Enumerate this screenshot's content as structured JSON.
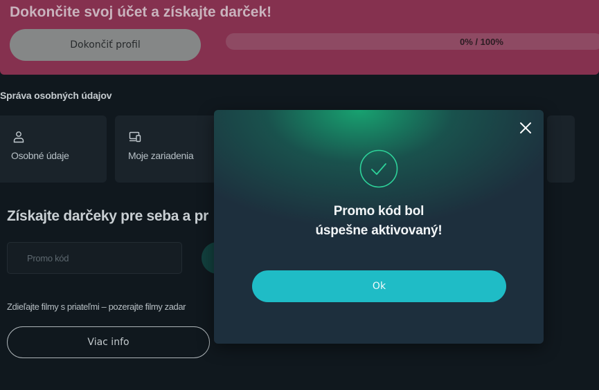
{
  "banner": {
    "title": "Dokončite svoj účet a získajte darček!",
    "finish_button": "Dokončiť profil",
    "progress_text": "0% / 100%",
    "progress_value": 0
  },
  "personal_data": {
    "section_title": "Správa osobných údajov",
    "cards": [
      {
        "label": "Osobné údaje",
        "icon": "user-icon"
      },
      {
        "label": "Moje zariadenia",
        "icon": "devices-icon"
      }
    ]
  },
  "gifts": {
    "title": "Získajte darčeky pre seba a pr",
    "promo_placeholder": "Promo kód",
    "share_text": "Zdieľajte filmy s priateľmi – pozerajte filmy zadar",
    "more_button": "Viac info"
  },
  "modal": {
    "message_line1": "Promo kód bol",
    "message_line2": "úspešne aktivovaný!",
    "ok_button": "Ok",
    "icons": {
      "close": "close-icon",
      "success": "check-circle-icon"
    }
  },
  "colors": {
    "background": "#10181e",
    "banner": "#85314f",
    "accent": "#1fbcc6",
    "success_green": "#17a873"
  }
}
